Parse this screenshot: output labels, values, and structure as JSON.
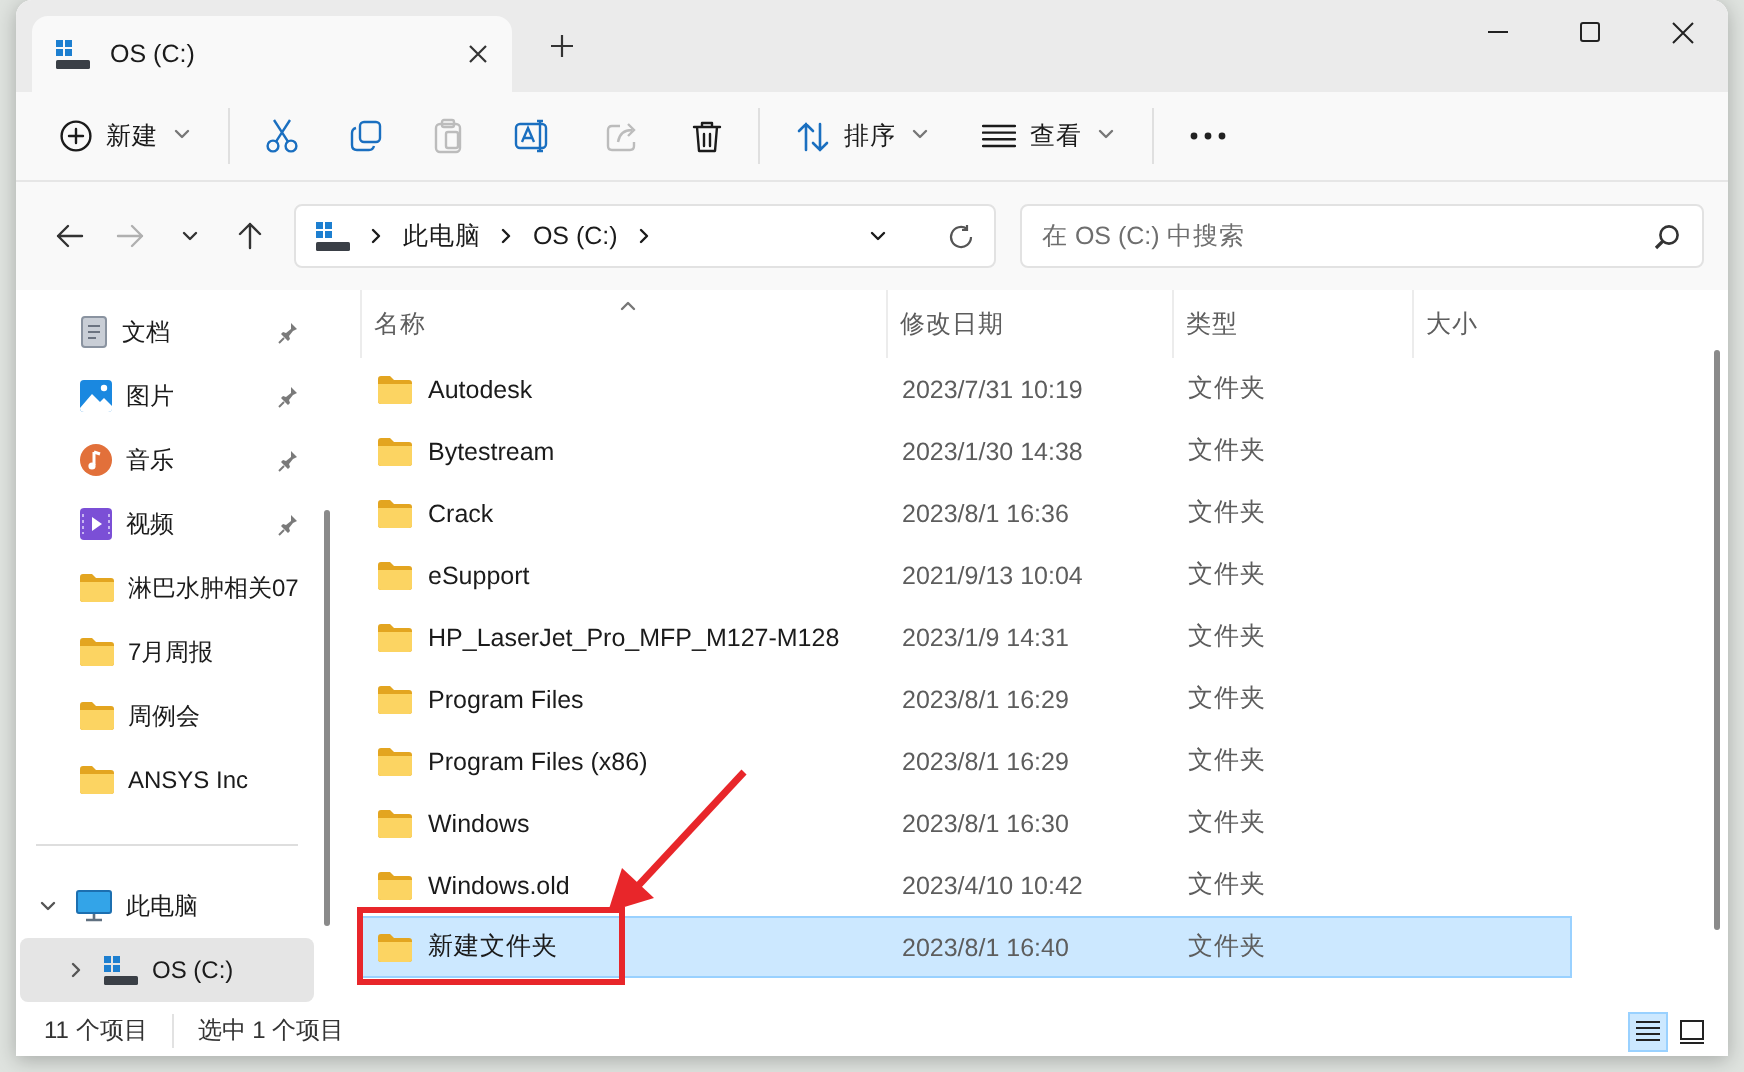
{
  "window": {
    "tab": {
      "title": "OS (C:)",
      "selected": true
    }
  },
  "toolbar": {
    "items": [
      {
        "kind": "new",
        "label": "新建",
        "dropdown": true,
        "disabled": false
      },
      {
        "kind": "cut",
        "disabled": false
      },
      {
        "kind": "copy",
        "disabled": false
      },
      {
        "kind": "paste",
        "disabled": true
      },
      {
        "kind": "rename",
        "disabled": false
      },
      {
        "kind": "share",
        "disabled": true
      },
      {
        "kind": "delete",
        "disabled": false
      },
      {
        "kind": "sort",
        "label": "排序",
        "dropdown": true,
        "disabled": false
      },
      {
        "kind": "view",
        "label": "查看",
        "dropdown": true,
        "disabled": false
      },
      {
        "kind": "more",
        "disabled": false
      }
    ]
  },
  "navigation": {
    "back": {
      "disabled": false
    },
    "forward": {
      "disabled": true
    }
  },
  "address_bar": {
    "breadcrumbs": [
      "此电脑",
      "OS (C:)"
    ]
  },
  "search": {
    "placeholder": "在 OS (C:) 中搜索"
  },
  "sidebar": {
    "quick_access": [
      {
        "kind": "documents",
        "label": "文档",
        "pinned": true,
        "selected": false
      },
      {
        "kind": "pictures",
        "label": "图片",
        "pinned": true,
        "selected": false
      },
      {
        "kind": "music",
        "label": "音乐",
        "pinned": true,
        "selected": false
      },
      {
        "kind": "videos",
        "label": "视频",
        "pinned": true,
        "selected": false
      },
      {
        "kind": "folder",
        "label": "淋巴水肿相关07",
        "pinned": false,
        "selected": false
      },
      {
        "kind": "folder",
        "label": "7月周报",
        "pinned": false,
        "selected": false
      },
      {
        "kind": "folder",
        "label": "周例会",
        "pinned": false,
        "selected": false
      },
      {
        "kind": "folder",
        "label": "ANSYS Inc",
        "pinned": false,
        "selected": false
      }
    ],
    "devices": [
      {
        "kind": "pc",
        "label": "此电脑",
        "expanded": true,
        "selected": false,
        "children": [
          {
            "kind": "drive",
            "label": "OS (C:)",
            "expanded": false,
            "selected": true
          }
        ]
      }
    ]
  },
  "file_list": {
    "columns": [
      {
        "label": "名称",
        "sorted": true
      },
      {
        "label": "修改日期",
        "sorted": false
      },
      {
        "label": "类型",
        "sorted": false
      },
      {
        "label": "大小",
        "sorted": false
      }
    ],
    "rows": [
      {
        "name": "Autodesk",
        "modified": "2023/7/31 10:19",
        "type": "文件夹",
        "selected": false,
        "annotated": false
      },
      {
        "name": "Bytestream",
        "modified": "2023/1/30 14:38",
        "type": "文件夹",
        "selected": false,
        "annotated": false
      },
      {
        "name": "Crack",
        "modified": "2023/8/1 16:36",
        "type": "文件夹",
        "selected": false,
        "annotated": false
      },
      {
        "name": "eSupport",
        "modified": "2021/9/13 10:04",
        "type": "文件夹",
        "selected": false,
        "annotated": false
      },
      {
        "name": "HP_LaserJet_Pro_MFP_M127-M128",
        "modified": "2023/1/9 14:31",
        "type": "文件夹",
        "selected": false,
        "annotated": false
      },
      {
        "name": "Program Files",
        "modified": "2023/8/1 16:29",
        "type": "文件夹",
        "selected": false,
        "annotated": false
      },
      {
        "name": "Program Files (x86)",
        "modified": "2023/8/1 16:29",
        "type": "文件夹",
        "selected": false,
        "annotated": false
      },
      {
        "name": "Windows",
        "modified": "2023/8/1 16:30",
        "type": "文件夹",
        "selected": false,
        "annotated": false
      },
      {
        "name": "Windows.old",
        "modified": "2023/4/10 10:42",
        "type": "文件夹",
        "selected": false,
        "annotated": false
      },
      {
        "name": "新建文件夹",
        "modified": "2023/8/1 16:40",
        "type": "文件夹",
        "selected": true,
        "annotated": true
      }
    ]
  },
  "status_bar": {
    "item_count": "11 个项目",
    "selection": "选中 1 个项目",
    "view_buttons": [
      {
        "kind": "details",
        "selected": true
      },
      {
        "kind": "tiles",
        "selected": false
      }
    ]
  }
}
